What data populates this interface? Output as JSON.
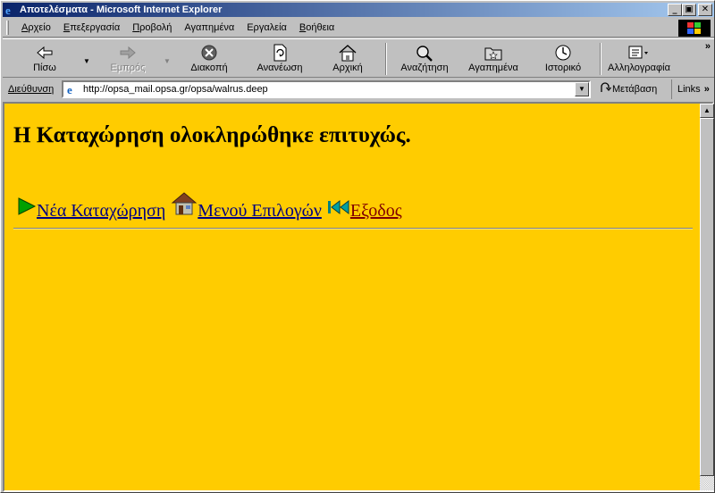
{
  "window": {
    "title": "Αποτελέσματα - Microsoft Internet Explorer",
    "minimize": "_",
    "maximize": "▣",
    "close": "✕"
  },
  "menu": {
    "items": [
      {
        "accel": "Α",
        "rest": "ρχείο"
      },
      {
        "accel": "Ε",
        "rest": "πεξεργασία"
      },
      {
        "accel": "Π",
        "rest": "ροβολή"
      },
      {
        "accel": "",
        "rest": "Αγαπημένα"
      },
      {
        "accel": "",
        "rest": "Εργαλεία"
      },
      {
        "accel": "Β",
        "rest": "οήθεια"
      }
    ]
  },
  "toolbar": {
    "back": "Πίσω",
    "forward": "Εμπρός",
    "stop": "Διακοπή",
    "refresh": "Ανανέωση",
    "home": "Αρχική",
    "search": "Αναζήτηση",
    "favorites": "Αγαπημένα",
    "history": "Ιστορικό",
    "mail": "Αλληλογραφία",
    "more": "»"
  },
  "address": {
    "label": "Διεύθυνση",
    "url": "http://opsa_mail.opsa.gr/opsa/walrus.deep",
    "go": "Μετάβαση",
    "links": "Links",
    "links_more": "»"
  },
  "page": {
    "heading": "Η Καταχώρηση ολοκληρώθηκε επιτυχώς.",
    "links": {
      "new_entry": "Νέα Καταχώρηση",
      "options_menu": "Μενού Επιλογών",
      "exit": "Εξοδος"
    }
  },
  "colors": {
    "page_background": "#ffcc00",
    "link": "#000080",
    "visited_link": "#800000",
    "titlebar": "#0a246a"
  },
  "icons": {
    "back": "back-arrow-icon",
    "forward": "forward-arrow-icon",
    "stop": "stop-icon",
    "refresh": "refresh-icon",
    "home": "home-icon",
    "search": "search-icon",
    "favorites": "favorites-icon",
    "history": "history-icon",
    "mail": "mail-icon",
    "new_entry": "green-arrow-icon",
    "options_menu": "house-icon",
    "exit": "rewind-icon"
  }
}
